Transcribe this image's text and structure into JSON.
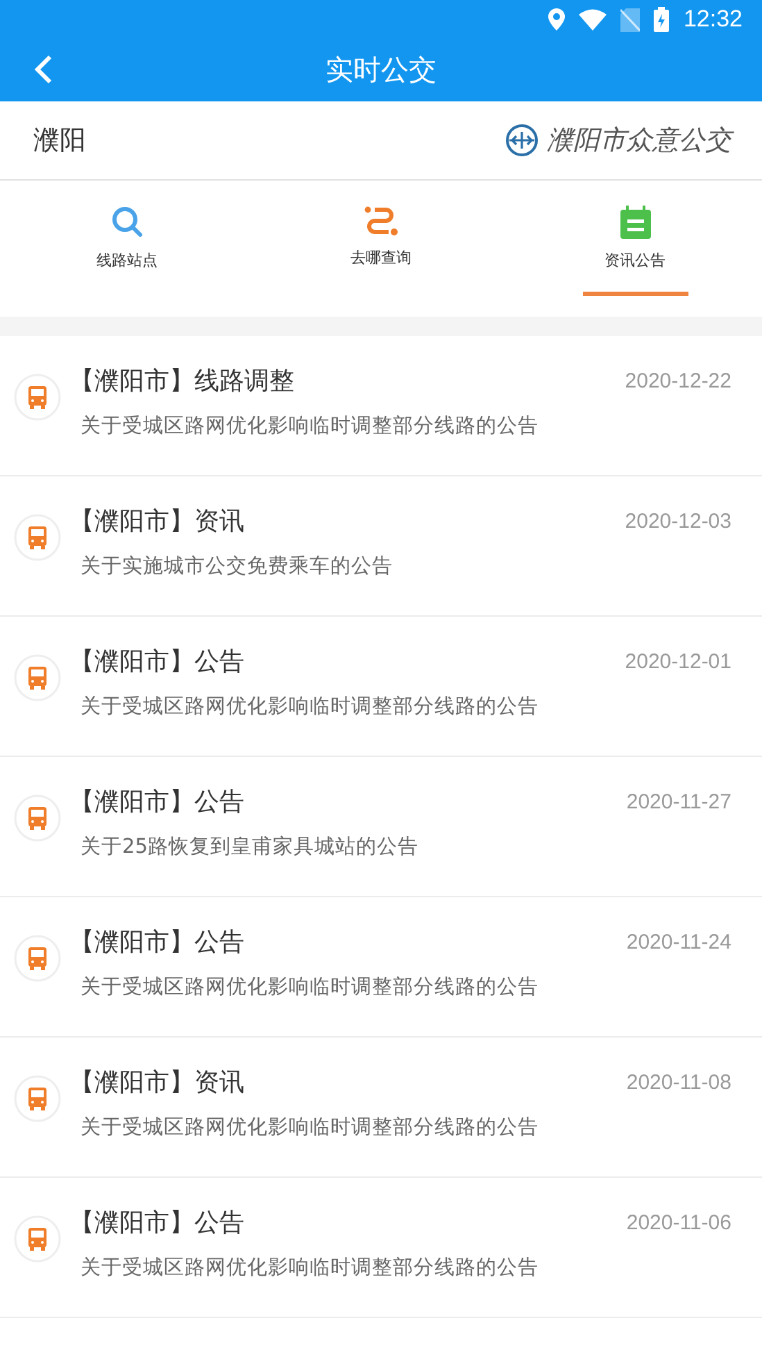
{
  "status_bar": {
    "time": "12:32"
  },
  "header": {
    "title": "实时公交"
  },
  "city_bar": {
    "city": "濮阳",
    "brand": "濮阳市众意公交"
  },
  "tabs": [
    {
      "label": "线路站点",
      "kind": "search",
      "selected": false
    },
    {
      "label": "去哪查询",
      "kind": "route",
      "selected": false
    },
    {
      "label": "资讯公告",
      "kind": "notice",
      "selected": true
    }
  ],
  "notices": [
    {
      "title": "【濮阳市】线路调整",
      "date": "2020-12-22",
      "summary": "关于受城区路网优化影响临时调整部分线路的公告"
    },
    {
      "title": "【濮阳市】资讯",
      "date": "2020-12-03",
      "summary": "关于实施城市公交免费乘车的公告"
    },
    {
      "title": "【濮阳市】公告",
      "date": "2020-12-01",
      "summary": "关于受城区路网优化影响临时调整部分线路的公告"
    },
    {
      "title": "【濮阳市】公告",
      "date": "2020-11-27",
      "summary": "关于25路恢复到皇甫家具城站的公告"
    },
    {
      "title": "【濮阳市】公告",
      "date": "2020-11-24",
      "summary": "关于受城区路网优化影响临时调整部分线路的公告"
    },
    {
      "title": "【濮阳市】资讯",
      "date": "2020-11-08",
      "summary": "关于受城区路网优化影响临时调整部分线路的公告"
    },
    {
      "title": "【濮阳市】公告",
      "date": "2020-11-06",
      "summary": "关于受城区路网优化影响临时调整部分线路的公告"
    }
  ]
}
